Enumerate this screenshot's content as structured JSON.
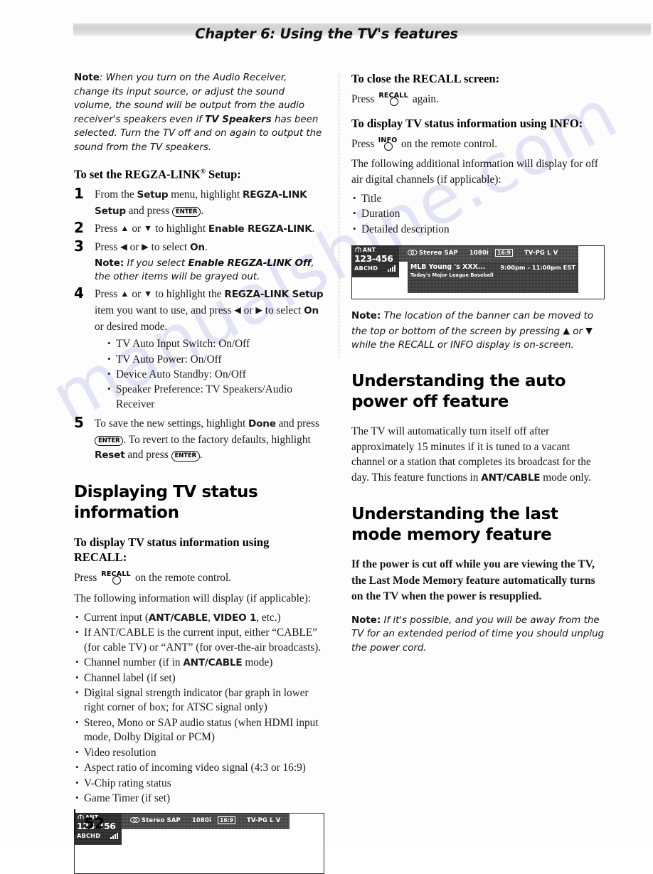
{
  "header": {
    "chapter_title": "Chapter 6: Using the TV's features"
  },
  "folio": {
    "page_number": "52"
  },
  "watermark": {
    "text": "manualshine.com"
  },
  "left_column": {
    "note_intro": {
      "label": "Note",
      "text_1": ": When you turn on the Audio Receiver, change its input source, or adjust the sound volume, the sound will be output from the audio receiver's speakers even if ",
      "emphasis": "TV Speakers",
      "text_2": " has been selected. Turn the TV off and on again to output the sound from the TV speakers."
    },
    "heading_regza": "To set the REGZA-LINK",
    "heading_regza_sup": "®",
    "heading_regza_tail": " Setup:",
    "steps": [
      {
        "num": "1",
        "part_1": "From the ",
        "b1": "Setup",
        "part_2": " menu, highlight ",
        "b2": "REGZA-LINK Setup",
        "part_3": " and press ",
        "enter": "ENTER",
        "part_4": "."
      },
      {
        "num": "2",
        "part_1": "Press ",
        "up": "▲",
        "part_2": " or ",
        "down": "▼",
        "part_3": " to highlight ",
        "b1": "Enable REGZA-LINK",
        "part_4": "."
      },
      {
        "num": "3",
        "part_1": "Press ",
        "left": "◀",
        "part_2": " or ",
        "right": "▶",
        "part_3": " to select ",
        "b1": "On",
        "part_4": ".",
        "note_label": "Note:",
        "note_1": " If you select ",
        "note_bold": "Enable REGZA-LINK Off",
        "note_2": ", the other items will be grayed out."
      },
      {
        "num": "4",
        "part_1": "Press ",
        "up": "▲",
        "part_2": " or ",
        "down": "▼",
        "part_3": " to highlight the ",
        "b1": "REGZA-LINK Setup",
        "part_4": " item you want to use, and press ",
        "left": "◀",
        "part_5": " or ",
        "right": "▶",
        "part_6": " to select ",
        "b2": "On",
        "part_7": " or desired mode."
      },
      {
        "num": "5",
        "part_1": "To save the new settings, highlight ",
        "b1": "Done",
        "part_2": " and press ",
        "enter_1": "ENTER",
        "part_3": ". To revert to the factory defaults, highlight ",
        "b2": "Reset",
        "part_4": " and press ",
        "enter_2": "ENTER",
        "part_5": "."
      }
    ],
    "regza_options": [
      "TV Auto Input Switch: On/Off",
      "TV Auto Power: On/Off",
      "Device Auto Standby: On/Off",
      "Speaker Preference: TV Speakers/Audio Receiver"
    ],
    "section_heading": "Displaying TV status information",
    "sub_heading_recall": "To display TV status information using RECALL:",
    "press_recall": {
      "press": "Press",
      "button_label": "RECALL",
      "tail": "on the remote control."
    },
    "following_info": "The following information will display (if applicable):",
    "recall_bullets": [
      {
        "p1": "Current input (",
        "b1": "ANT/CABLE",
        "p2": ", ",
        "b2": "VIDEO 1",
        "p3": ", etc.)"
      },
      {
        "p1": "If ANT/CABLE is the current input, either “CABLE” (for cable TV) or “ANT” (for over-the-air broadcasts)."
      },
      {
        "p1": "Channel number (if in ",
        "b1": "ANT/CABLE",
        "p2": " mode)"
      },
      {
        "p1": "Channel label (if set)"
      },
      {
        "p1": "Digital signal strength indicator (bar graph in lower right corner of box; for ATSC signal only)"
      },
      {
        "p1": "Stereo, Mono or SAP audio status (when HDMI input mode, Dolby Digital or PCM)"
      },
      {
        "p1": "Video resolution"
      },
      {
        "p1": "Aspect ratio of incoming video signal (4:3 or 16:9)"
      },
      {
        "p1": "V-Chip rating status"
      },
      {
        "p1": "Game Timer (if set)"
      }
    ],
    "recall_figure": {
      "source": "ANT",
      "channel_number": "123-456",
      "channel_label": "ABCHD",
      "audio": "Stereo SAP",
      "resolution": "1080i",
      "aspect": "16:9",
      "rating": "TV-PG  L  V"
    }
  },
  "right_column": {
    "heading_close_recall": "To close the RECALL screen:",
    "press_recall_again": {
      "press": "Press",
      "button_label": "RECALL",
      "tail": "again."
    },
    "heading_info": "To display TV status information using INFO:",
    "press_info": {
      "press": "Press",
      "button_label": "INFO",
      "tail": "on the remote control."
    },
    "additional_info": "The following additional information will display for off air digital channels (if applicable):",
    "info_bullets": [
      "Title",
      "Duration",
      "Detailed description"
    ],
    "info_figure": {
      "source": "ANT",
      "channel_number": "123-456",
      "channel_label": "ABCHD",
      "audio": "Stereo SAP",
      "resolution": "1080i",
      "aspect": "16:9",
      "rating": "TV-PG  L  V",
      "program_title": "MLB Young 's XXX...",
      "program_time": "9:00pm - 11:00pm EST",
      "program_desc": "Today's Major League Baseball"
    },
    "note_banner": {
      "label": "Note:",
      "text_1": " The location of the banner can be moved to the top or bottom of the screen by pressing ",
      "up": "▲",
      "text_2": " or ",
      "down": "▼",
      "text_3": " while the RECALL or INFO display is on-screen."
    },
    "heading_auto_power": "Understanding the auto power off feature",
    "auto_power_body": {
      "p1": "The TV will automatically turn itself off after approximately 15 minutes if it is tuned to a vacant channel or a station that completes its broadcast for the day. This feature functions in ",
      "b1": "ANT/CABLE",
      "p2": " mode only."
    },
    "heading_last_mode": "Understanding the last mode memory feature",
    "last_mode_lead": "If the power is cut off while you are viewing the TV, the Last Mode Memory feature automatically turns on the TV when the power is resupplied.",
    "note_unplug": {
      "label": "Note:",
      "text": " If it's possible, and you will be away from the TV for an extended period of time you should unplug the power cord."
    }
  }
}
